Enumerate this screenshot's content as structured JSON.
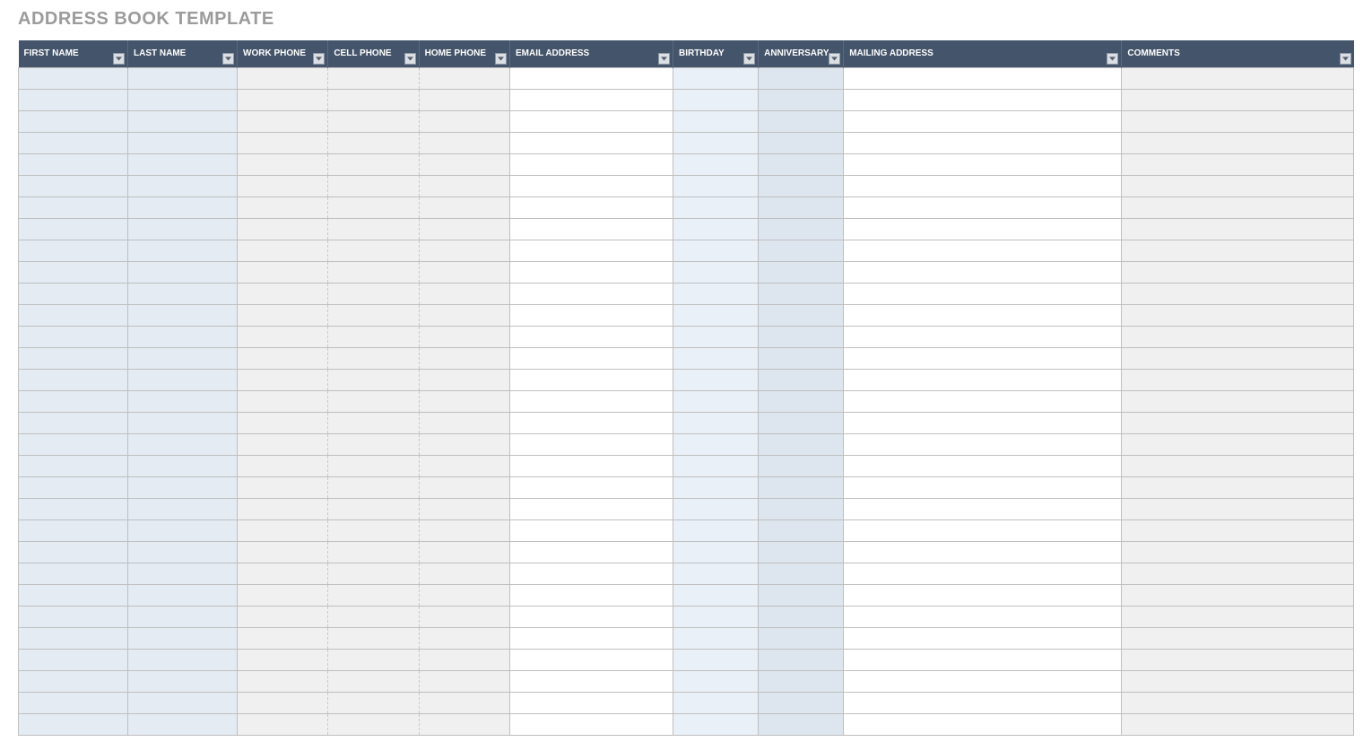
{
  "title": "ADDRESS BOOK TEMPLATE",
  "columns": [
    {
      "key": "first_name",
      "label": "FIRST NAME"
    },
    {
      "key": "last_name",
      "label": "LAST NAME"
    },
    {
      "key": "work_phone",
      "label": "WORK PHONE"
    },
    {
      "key": "cell_phone",
      "label": "CELL PHONE"
    },
    {
      "key": "home_phone",
      "label": "HOME PHONE"
    },
    {
      "key": "email",
      "label": "EMAIL ADDRESS"
    },
    {
      "key": "birthday",
      "label": "BIRTHDAY"
    },
    {
      "key": "anniversary",
      "label": "ANNIVERSARY"
    },
    {
      "key": "mailing_address",
      "label": "MAILING ADDRESS"
    },
    {
      "key": "comments",
      "label": "COMMENTS"
    }
  ],
  "row_count": 31,
  "rows": [],
  "colors": {
    "header": "#44546a",
    "title": "#9b9b9b",
    "name_fill": "#e4ebf2",
    "phone_fill": "#f0f0f0",
    "birthday_fill": "#eaf0f8",
    "anniversary_fill": "#dde5ee",
    "comments_fill": "#f0f0f0"
  }
}
